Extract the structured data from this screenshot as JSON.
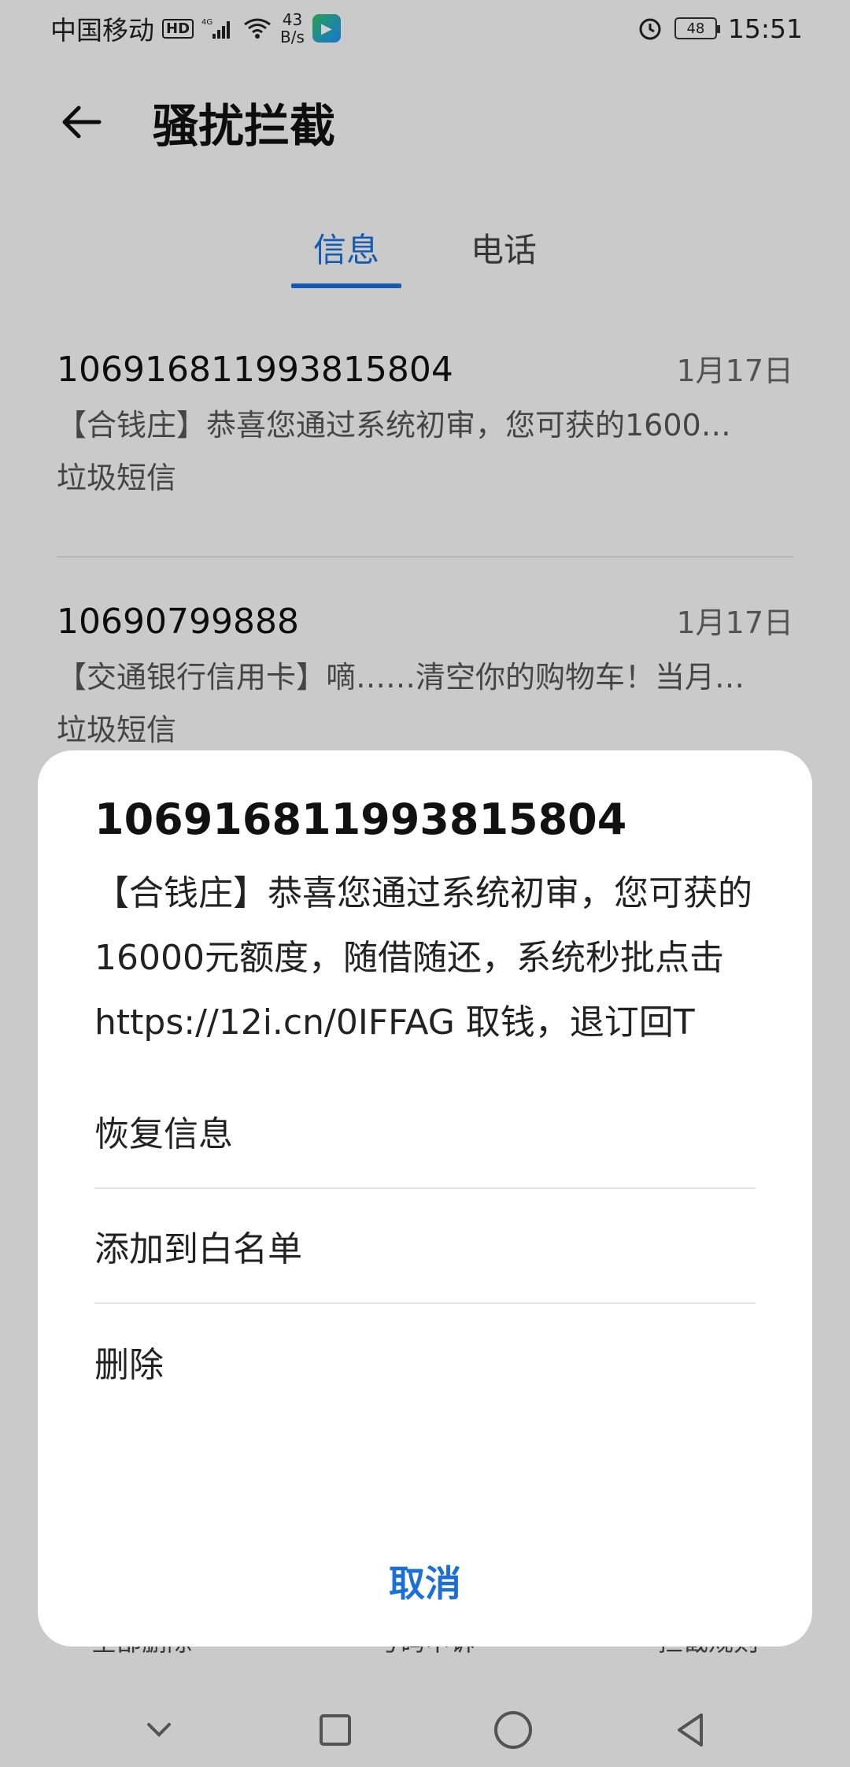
{
  "status_bar": {
    "carrier": "中国移动",
    "hd_badge": "HD",
    "network": "4G",
    "speed_value": "43",
    "speed_unit": "B/s",
    "battery": "48",
    "time": "15:51"
  },
  "app_bar": {
    "title": "骚扰拦截"
  },
  "tabs": [
    {
      "label": "信息",
      "active": true
    },
    {
      "label": "电话",
      "active": false
    }
  ],
  "messages": [
    {
      "sender": "106916811993815804",
      "date": "1月17日",
      "preview": "【合钱庄】恭喜您通过系统初审，您可获的1600…",
      "tag": "垃圾短信"
    },
    {
      "sender": "10690799888",
      "date": "1月17日",
      "preview": "【交通银行信用卡】嘀……清空你的购物车！当月…",
      "tag": "垃圾短信"
    }
  ],
  "bottom_actions": {
    "delete_all": "全部删除",
    "number_appeal": "号码申诉",
    "rules": "拦截规则"
  },
  "dialog": {
    "title": "106916811993815804",
    "body": "【合钱庄】恭喜您通过系统初审，您可获的16000元额度，随借随还，系统秒批点击 https://12i.cn/0IFFAG 取钱，退订回T",
    "options": [
      {
        "label": "恢复信息"
      },
      {
        "label": "添加到白名单"
      },
      {
        "label": "删除"
      }
    ],
    "cancel": "取消"
  },
  "colors": {
    "accent": "#1a6fd8"
  }
}
